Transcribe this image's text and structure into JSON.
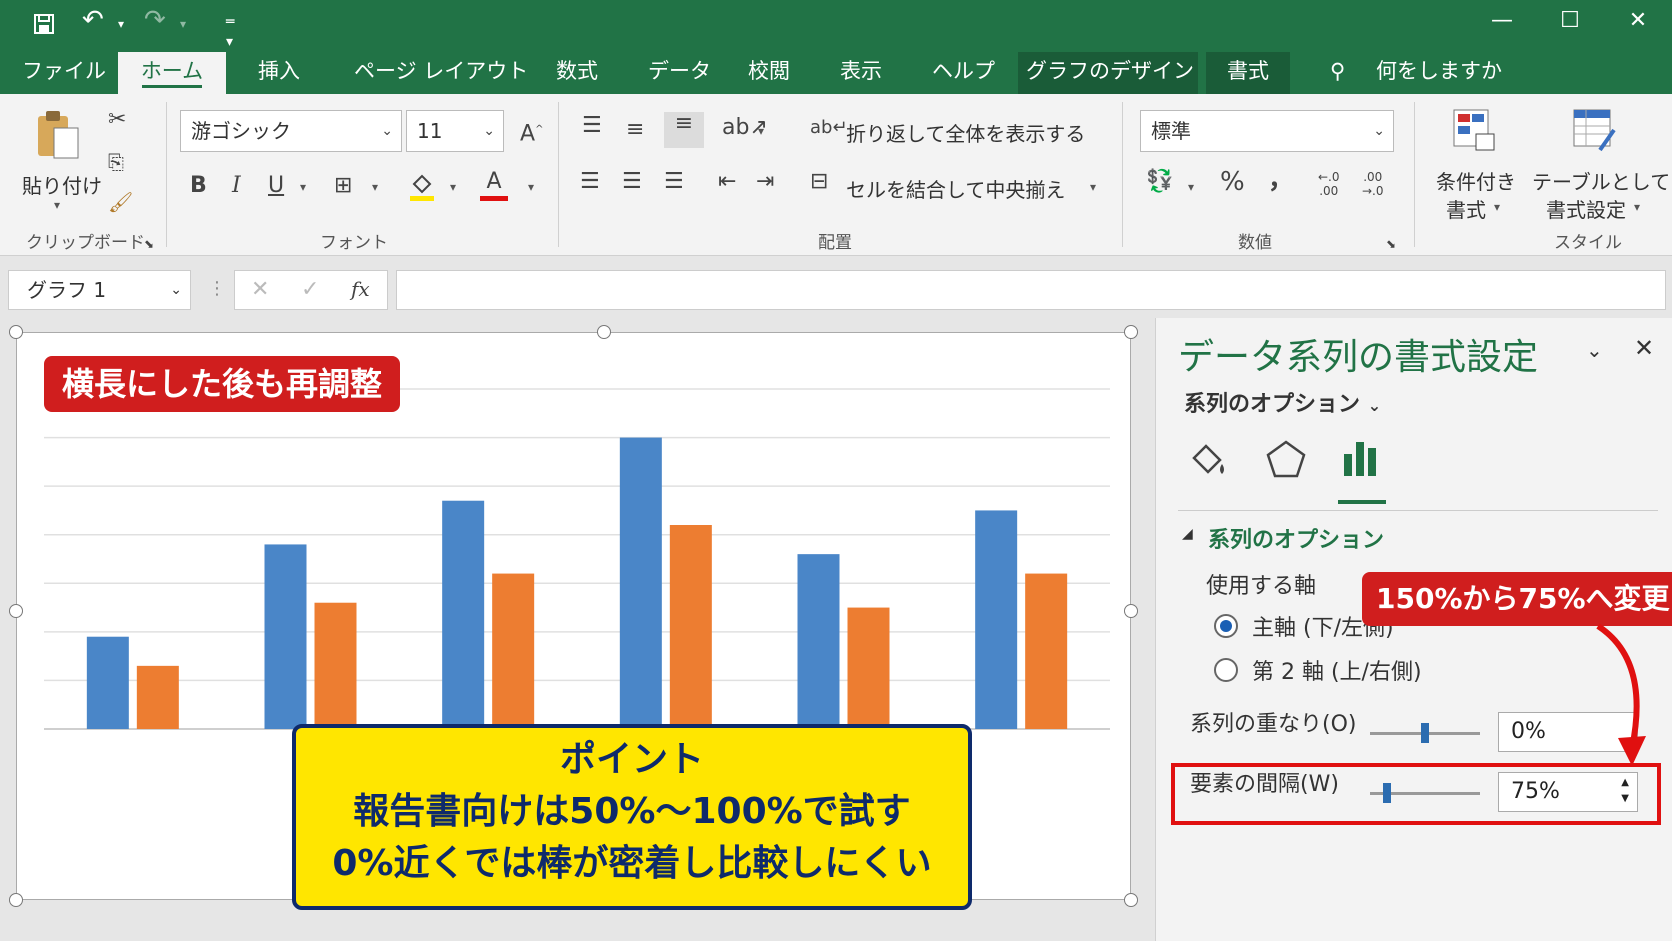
{
  "titlebar": {
    "save_icon": "save-icon",
    "undo_icon": "undo-icon",
    "redo_icon": "redo-icon",
    "qat_icon": "customize-qat-icon"
  },
  "tabs": [
    {
      "label": "ファイル"
    },
    {
      "label": "ホーム"
    },
    {
      "label": "挿入"
    },
    {
      "label": "ページ レイアウト"
    },
    {
      "label": "数式"
    },
    {
      "label": "データ"
    },
    {
      "label": "校閲"
    },
    {
      "label": "表示"
    },
    {
      "label": "ヘルプ"
    },
    {
      "label": "グラフのデザイン"
    },
    {
      "label": "書式"
    }
  ],
  "tell_me": "何をしますか",
  "ribbon": {
    "paste_label": "貼り付け",
    "clipboard_label": "クリップボード",
    "font_name": "游ゴシック",
    "font_size": "11",
    "font_label": "フォント",
    "wrap_text": "折り返して全体を表示する",
    "merge_center": "セルを結合して中央揃え",
    "alignment_label": "配置",
    "number_format": "標準",
    "number_label": "数値",
    "cond_format_1": "条件付き",
    "cond_format_2": "書式",
    "table_format_1": "テーブルとして",
    "table_format_2": "書式設定",
    "styles_label": "スタイル",
    "bold": "B",
    "italic": "I",
    "underline": "U",
    "font_color": "A",
    "percent": "%",
    "comma": "，"
  },
  "formula_bar": {
    "name_box": "グラフ 1",
    "fx": "fx"
  },
  "chart_data": {
    "type": "bar",
    "categories": [
      "",
      "",
      "",
      "",
      "",
      ""
    ],
    "series": [
      {
        "color": "#4a86c8",
        "values": [
          1.9,
          3.8,
          4.7,
          6.0,
          3.6,
          4.5
        ]
      },
      {
        "color": "#ed7d31",
        "values": [
          1.3,
          2.6,
          3.2,
          4.2,
          2.5,
          3.2
        ]
      }
    ],
    "ylim": [
      0,
      7
    ],
    "grid": true
  },
  "annotations": {
    "top_label": "横長にした後も再調整",
    "point_title": "ポイント",
    "point_line1": "報告書向けは50%〜100%で試す",
    "point_line2": "0%近くでは棒が密着し比較しにくい",
    "change_label": "150%から75%へ変更"
  },
  "pane": {
    "title": "データ系列の書式設定",
    "options_dropdown": "系列のオプション",
    "section_title": "系列のオプション",
    "axis_label": "使用する軸",
    "primary_axis": "主軸 (下/左側)",
    "secondary_axis": "第 2 軸 (上/右側)",
    "overlap_label": "系列の重なり(O)",
    "overlap_value": "0%",
    "overlap_level": 0.5,
    "gap_label": "要素の間隔(W)",
    "gap_value": "75%",
    "gap_level": 0.15
  }
}
